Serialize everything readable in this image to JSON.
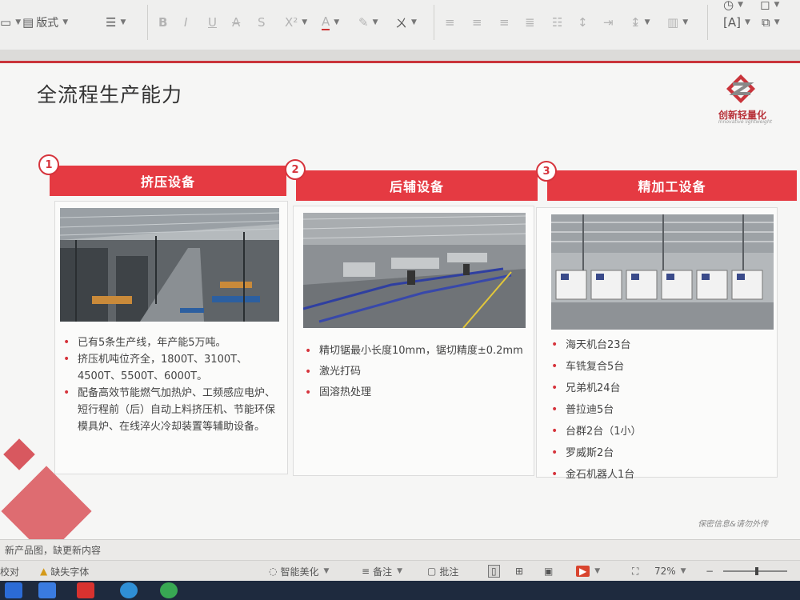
{
  "toolbar": {
    "layout_label": "版式",
    "format_icons": [
      "bold",
      "italic",
      "underline",
      "strikethrough",
      "shadow",
      "superscript",
      "font-color",
      "highlight",
      "phonetic"
    ],
    "para_icons": [
      "align-left",
      "align-center",
      "align-right",
      "justify",
      "distributed",
      "line-spacing",
      "indent",
      "line-height",
      "columns"
    ]
  },
  "slide": {
    "title": "全流程生产能力",
    "logo": {
      "text": "创新轻量化",
      "sub": "Innovative lightweight"
    },
    "cards": [
      {
        "num": "1",
        "title": "挤压设备",
        "bullets": [
          "已有5条生产线，年产能5万吨。",
          "挤压机吨位齐全，1800T、3100T、4500T、5500T、6000T。",
          "配备高效节能燃气加热炉、工频感应电炉、短行程前（后）自动上料挤压机、节能环保模具炉、在线淬火冷却装置等辅助设备。"
        ]
      },
      {
        "num": "2",
        "title": "后辅设备",
        "bullets": [
          "精切锯最小长度10mm，锯切精度±0.2mm",
          "激光打码",
          "固溶热处理"
        ]
      },
      {
        "num": "3",
        "title": "精加工设备",
        "bullets": [
          "海天机台23台",
          "车铣复合5台",
          "兄弟机24台",
          "普拉迪5台",
          "台群2台（1小）",
          "罗威斯2台",
          "金石机器人1台"
        ]
      }
    ],
    "footnote": "保密信息&请勿外传"
  },
  "notes_text": "新产品图，缺更新内容",
  "statusbar": {
    "left_label": "校对",
    "missing_font": "缺失字体",
    "beautify": "智能美化",
    "notes": "备注",
    "comments": "批注",
    "zoom": "72%"
  },
  "colors": {
    "accent": "#e53a42",
    "accent_dark": "#c9343b"
  }
}
